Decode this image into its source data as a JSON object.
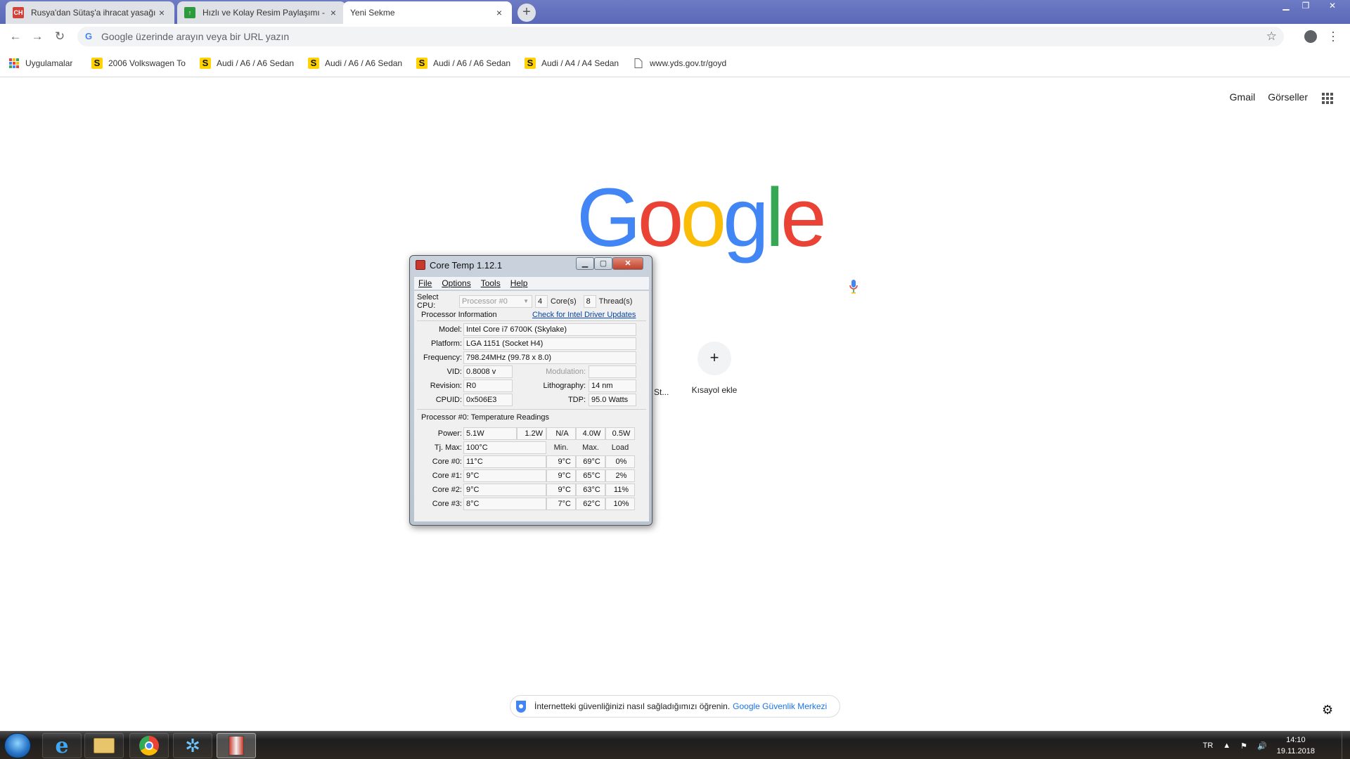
{
  "browser": {
    "tabs": [
      {
        "title": "Rusya'dan Sütaş'a ihracat yasağı!",
        "close": "×"
      },
      {
        "title": "Hızlı ve Kolay Resim Paylaşımı - r",
        "close": "×"
      },
      {
        "title": "Yeni Sekme",
        "close": "×"
      }
    ],
    "new_tab": "+",
    "omnibox_placeholder": "Google üzerinde arayın veya bir URL yazın",
    "bookmarks": [
      {
        "label": "Uygulamalar",
        "icon": "apps-grid-icon"
      },
      {
        "label": "2006 Volkswagen To",
        "icon": "s"
      },
      {
        "label": "Audi / A6 / A6 Sedan",
        "icon": "s"
      },
      {
        "label": "Audi / A6 / A6 Sedan",
        "icon": "s"
      },
      {
        "label": "Audi / A6 / A6 Sedan",
        "icon": "s"
      },
      {
        "label": "Audi / A4 / A4 Sedan",
        "icon": "s"
      },
      {
        "label": "www.yds.gov.tr/goyd",
        "icon": "page"
      }
    ]
  },
  "ntp": {
    "links": [
      "Gmail",
      "Görseller"
    ],
    "logo": [
      "G",
      "o",
      "o",
      "g",
      "l",
      "e"
    ],
    "logo_colors": [
      "#4285f4",
      "#ea4335",
      "#fbbc05",
      "#4285f4",
      "#34a853",
      "#ea4335"
    ],
    "shortcut_partial": "St...",
    "add_shortcut_icon": "+",
    "add_shortcut_label": "Kısayol ekle",
    "security_text": "İnternetteki güvenliğinizi nasıl sağladığımızı öğrenin.",
    "security_link": "Google Güvenlik Merkezi"
  },
  "coretemp": {
    "title": "Core Temp 1.12.1",
    "menu": [
      "File",
      "Options",
      "Tools",
      "Help"
    ],
    "select_cpu_label": "Select CPU:",
    "select_cpu_value": "Processor #0",
    "cores": "4",
    "cores_label": "Core(s)",
    "threads": "8",
    "threads_label": "Thread(s)",
    "processor_info_label": "Processor Information",
    "driver_link": "Check for Intel Driver Updates",
    "info": {
      "model_label": "Model:",
      "model": "Intel Core i7 6700K (Skylake)",
      "platform_label": "Platform:",
      "platform": "LGA 1151 (Socket H4)",
      "frequency_label": "Frequency:",
      "frequency": "798.24MHz (99.78 x 8.0)",
      "vid_label": "VID:",
      "vid": "0.8008 v",
      "modulation_label": "Modulation:",
      "modulation": "",
      "revision_label": "Revision:",
      "revision": "R0",
      "lithography_label": "Lithography:",
      "lithography": "14 nm",
      "cpuid_label": "CPUID:",
      "cpuid": "0x506E3",
      "tdp_label": "TDP:",
      "tdp": "95.0 Watts"
    },
    "temp_section_label": "Processor #0: Temperature Readings",
    "power_label": "Power:",
    "power": [
      "5.1W",
      "1.2W",
      "N/A",
      "4.0W",
      "0.5W"
    ],
    "tjmax_label": "Tj. Max:",
    "tjmax": "100°C",
    "headers": [
      "Min.",
      "Max.",
      "Load"
    ],
    "cores_readings": [
      {
        "label": "Core #0:",
        "temp": "11°C",
        "min": "9°C",
        "max": "69°C",
        "load": "0%"
      },
      {
        "label": "Core #1:",
        "temp": "9°C",
        "min": "9°C",
        "max": "65°C",
        "load": "2%"
      },
      {
        "label": "Core #2:",
        "temp": "9°C",
        "min": "9°C",
        "max": "63°C",
        "load": "11%"
      },
      {
        "label": "Core #3:",
        "temp": "8°C",
        "min": "7°C",
        "max": "62°C",
        "load": "10%"
      }
    ]
  },
  "taskbar": {
    "items": [
      "start-orb",
      "internet-explorer-icon",
      "file-explorer-icon",
      "chrome-icon",
      "network-app-icon",
      "coretemp-icon"
    ],
    "language": "TR",
    "time": "14:10",
    "date": "19.11.2018"
  }
}
